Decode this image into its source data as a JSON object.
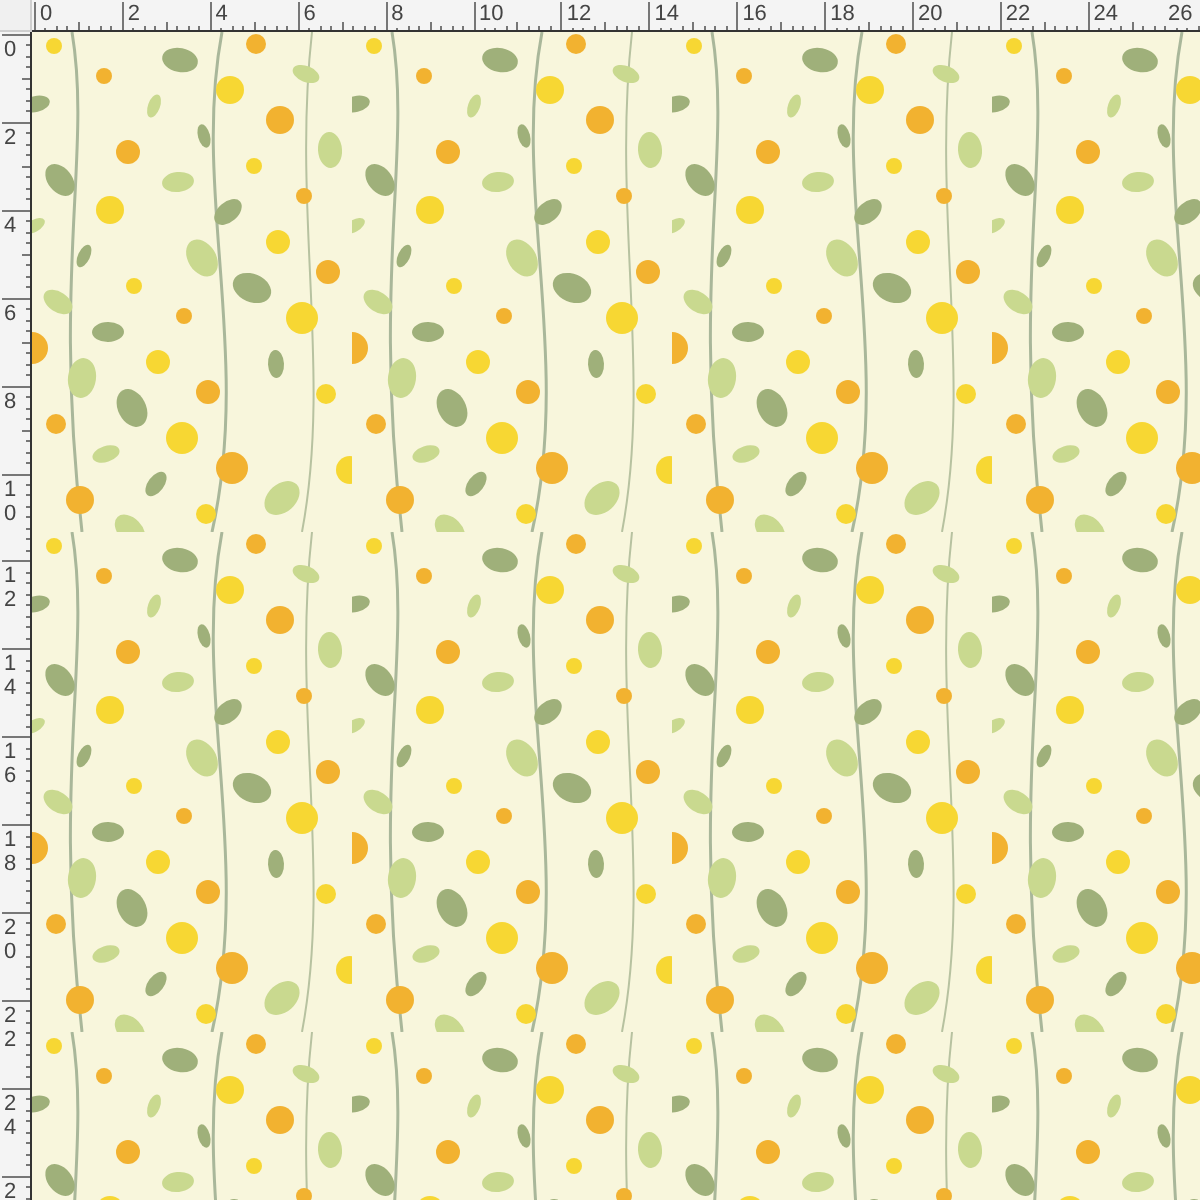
{
  "top_ruler": {
    "labels": [
      "0",
      "2",
      "4",
      "6",
      "8",
      "10",
      "12",
      "14",
      "16",
      "18",
      "20",
      "22",
      "24",
      "26"
    ]
  },
  "left_ruler": {
    "labels": [
      "0",
      "2",
      "4",
      "6",
      "8",
      "10",
      "12",
      "14",
      "16",
      "18",
      "20",
      "22",
      "24",
      "2"
    ]
  }
}
